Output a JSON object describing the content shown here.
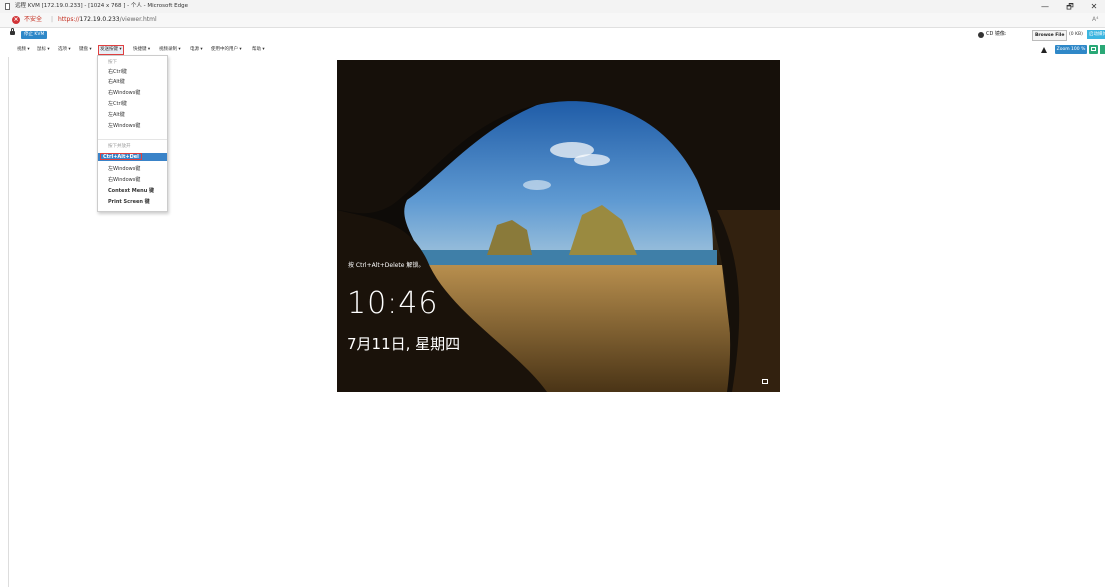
{
  "browser": {
    "window_title": "远程 KVM [172.19.0.233] - [1024 x 768 ] - 个人 - Microsoft Edge",
    "minimize": "—",
    "restore": "🗗",
    "close": "✕",
    "insecure_label": "不安全",
    "separator": "|",
    "url_scheme": "https://",
    "url_host": "172.19.0.233",
    "url_path": "/viewer.html",
    "read_aloud": "A⁴"
  },
  "kvm": {
    "stop_label": "停止 KVM",
    "cd_label": "CD 镜像:",
    "browse_label": "Browse File",
    "browse_size": "(0 KB)",
    "activate_label": "启动媒体",
    "zoom_label": "Zoom 100 %"
  },
  "menu": {
    "items": [
      "视频 ▾",
      "鼠标 ▾",
      "选项 ▾",
      "键盘 ▾",
      "发送按键 ▾",
      "快捷键 ▾",
      "视频录制 ▾",
      "电源 ▾",
      "使用中的用户 ▾",
      "帮助 ▾"
    ]
  },
  "dropdown": {
    "hold_header": "按下",
    "hold_items": [
      "右Ctrl键",
      "右Alt键",
      "右Windows键",
      "左Ctrl键",
      "左Alt键",
      "左Windows键"
    ],
    "press_release_header": "按下并放开",
    "selected": "Ctrl+Alt+Del",
    "press_items": [
      "左Windows键",
      "右Windows键",
      "Context Menu 键",
      "Print Screen 键"
    ]
  },
  "lockscreen": {
    "unlock_hint": "按 Ctrl+Alt+Delete 解锁。",
    "time": "10:46",
    "date": "7月11日, 星期四"
  },
  "icons": [
    "page-icon",
    "warning-icon",
    "lock-icon",
    "cd-icon",
    "alert-triangle-icon",
    "monitor-icon",
    "network-icon"
  ]
}
